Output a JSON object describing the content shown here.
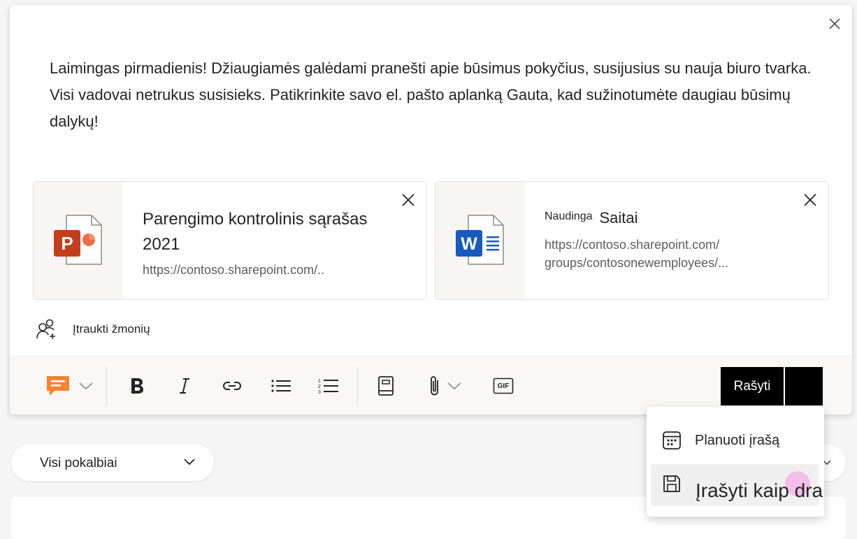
{
  "message": {
    "text": "Laimingas pirmadienis! Džiaugiamės galėdami pranešti apie būsimus pokyčius, susijusius su nauja biuro tvarka. Visi vadovai netrukus susisieks. Patikrinkite savo el. pašto aplanką Gauta, kad sužinotumėte daugiau būsimų dalykų!"
  },
  "attachments": [
    {
      "icon": "powerpoint-icon",
      "title": "Parengimo kontrolinis sąrašas 2021",
      "url": "https://contoso.sharepoint.com/.."
    },
    {
      "icon": "word-icon",
      "title_prefix": "Naudinga",
      "title": "Saitai",
      "url_line1": "https://contoso.sharepoint.com/",
      "url_line2": "groups/contosonewemployees/..."
    }
  ],
  "people": {
    "label": "Įtraukti žmonių"
  },
  "toolbar": {
    "items": [
      "message-type-icon",
      "bold-icon",
      "italic-icon",
      "link-icon",
      "bullet-list-icon",
      "numbered-list-icon",
      "notebook-icon",
      "attach-icon",
      "gif-icon"
    ],
    "gif_text": "GIF",
    "post_label": "Rašyti",
    "message_type_color": "#f7832f"
  },
  "filter": {
    "label": "Visi pokalbiai"
  },
  "post_menu": {
    "items": [
      {
        "label": "Planuoti įrašą",
        "icon": "calendar-icon"
      },
      {
        "label": "Įrašyti kaip drab",
        "icon": "save-icon"
      }
    ]
  },
  "colors": {
    "powerpoint": "#c43e1c",
    "word": "#185abd",
    "post_button": "#000000"
  }
}
